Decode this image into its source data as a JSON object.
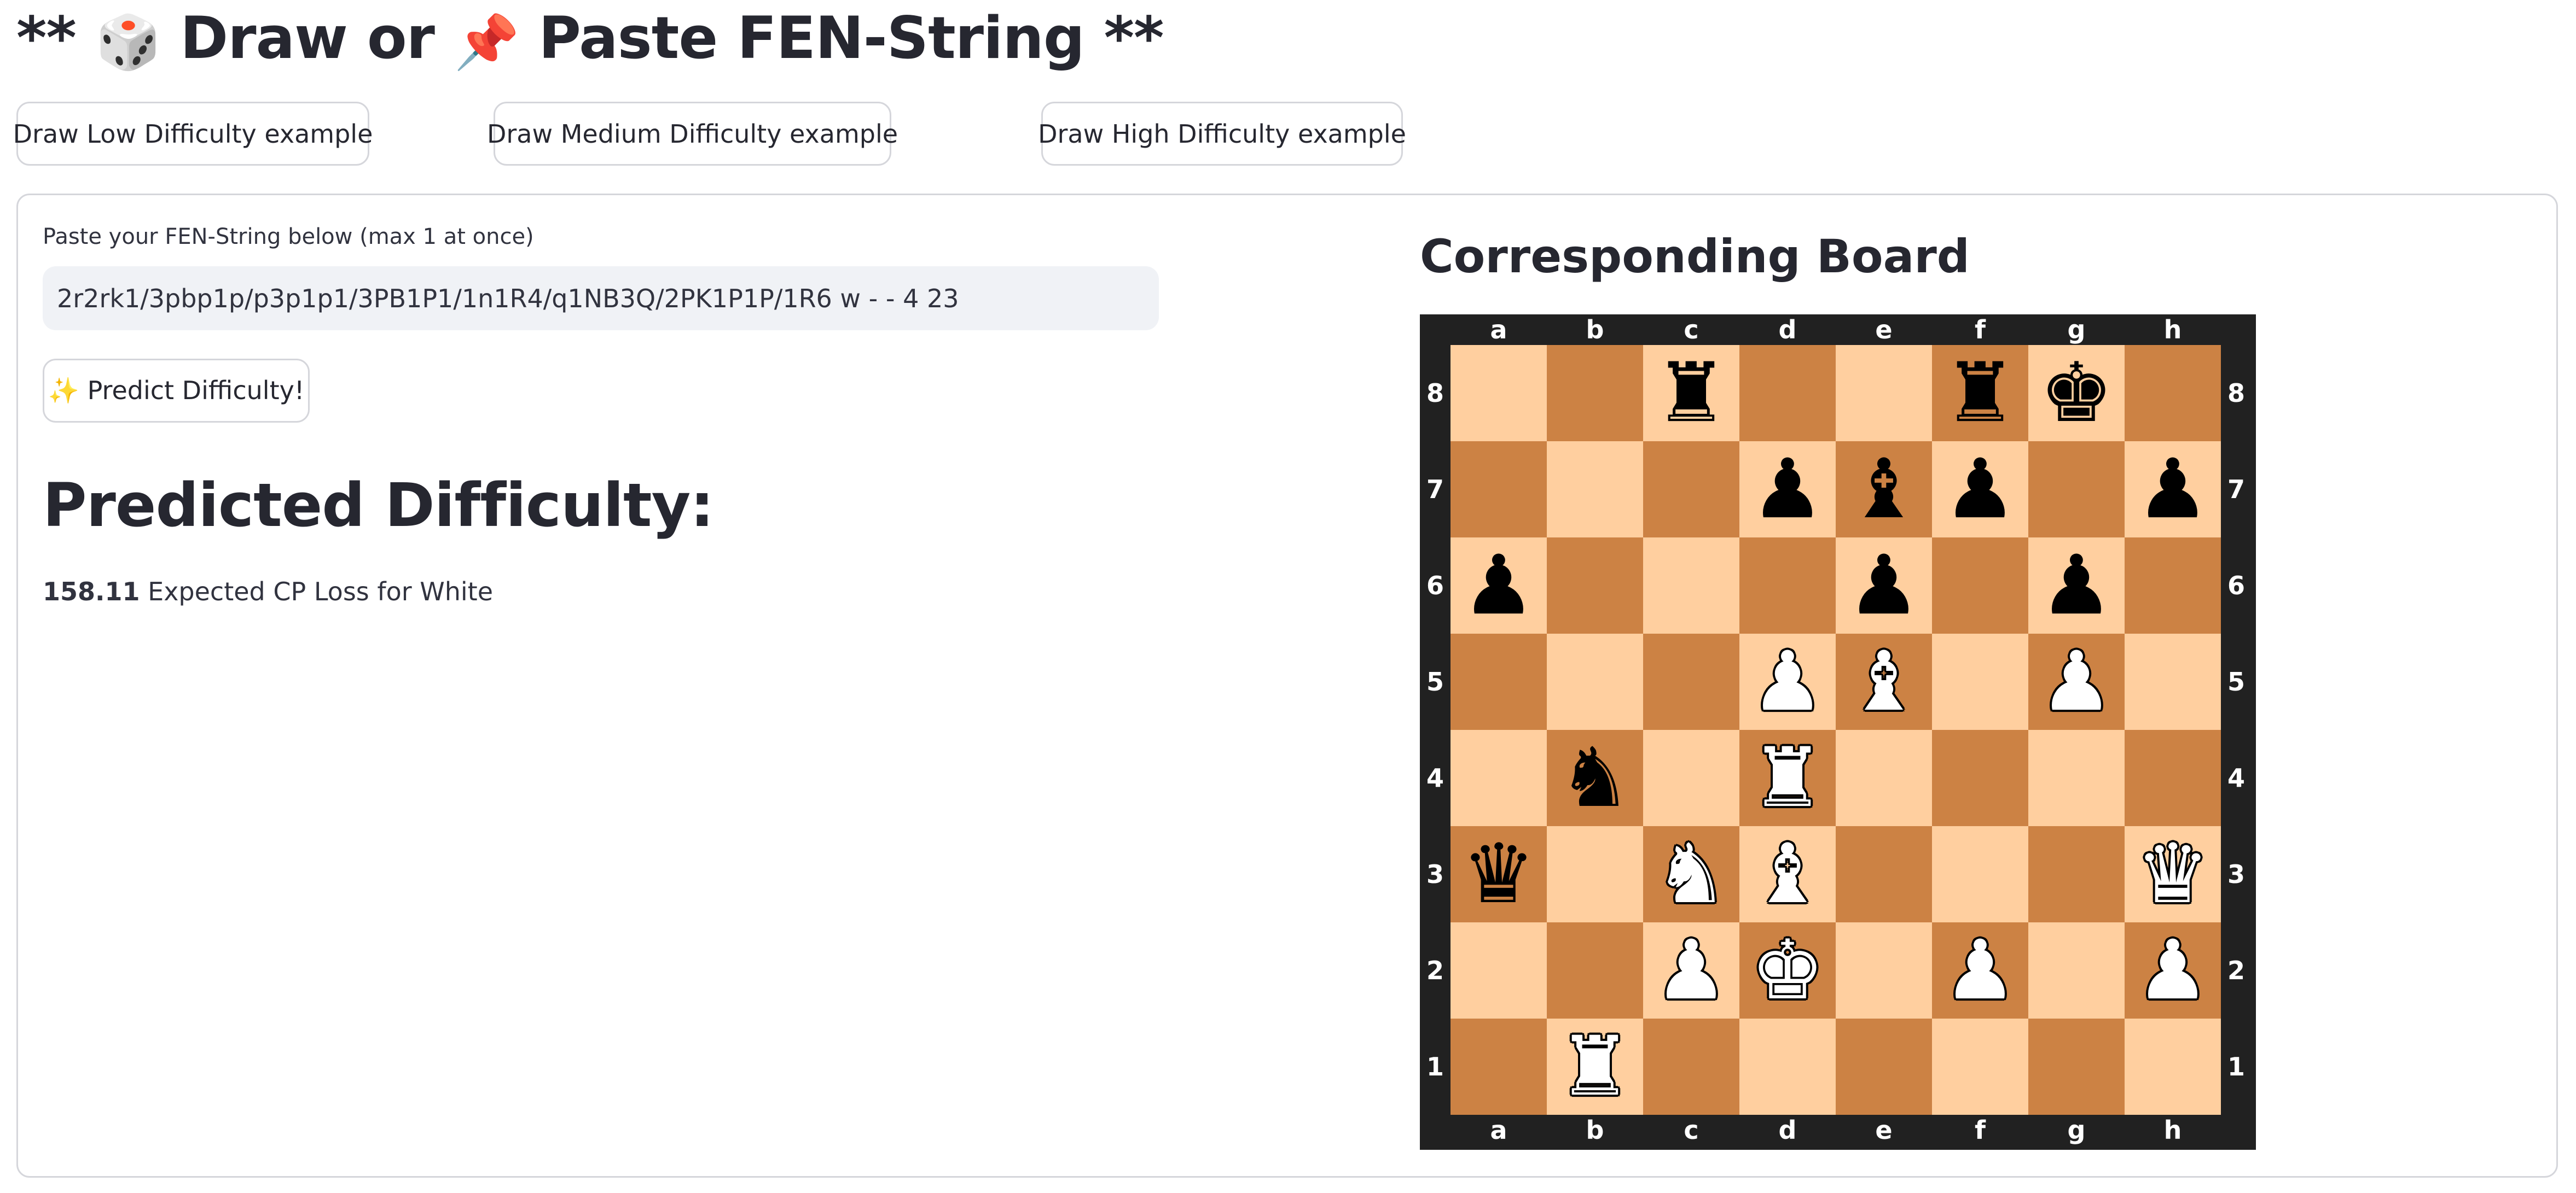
{
  "header": {
    "title_prefix": "** ",
    "dice_emoji": "🎲",
    "title_mid": " Draw or ",
    "pin_emoji": "📌",
    "title_suffix": " Paste FEN-String **"
  },
  "buttons": {
    "low": "Draw Low Difficulty example",
    "medium": "Draw Medium Difficulty example",
    "high": "Draw High Difficulty example",
    "predict": "✨ Predict Difficulty!"
  },
  "fen": {
    "label": "Paste your FEN-String below (max 1 at once)",
    "value": "2r2rk1/3pbp1p/p3p1p1/3PB1P1/1n1R4/q1NB3Q/2PK1P1P/1R6 w - - 4 23"
  },
  "prediction": {
    "heading": "Predicted Difficulty:",
    "value": "158.11",
    "text": "Expected CP Loss for White"
  },
  "board": {
    "title": "Corresponding Board",
    "files": [
      "a",
      "b",
      "c",
      "d",
      "e",
      "f",
      "g",
      "h"
    ],
    "ranks": [
      "8",
      "7",
      "6",
      "5",
      "4",
      "3",
      "2",
      "1"
    ],
    "colors": {
      "light": "#ffcf9f",
      "dark": "#cc8244",
      "frame": "#212121"
    },
    "rows": [
      "..r..rk.",
      "...pbp.p",
      "p...p.p.",
      "...PB.P.",
      ".n.R....",
      "q.NB...Q",
      "..PK.P.P",
      ".R......"
    ]
  }
}
